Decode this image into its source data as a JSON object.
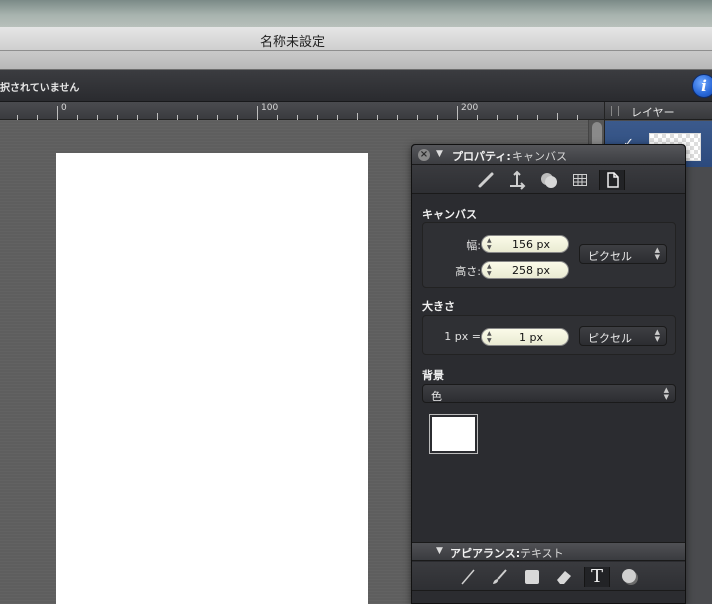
{
  "window": {
    "title": "名称未設定"
  },
  "statusbar": {
    "text": "択されていません",
    "info_label": "i"
  },
  "ruler": {
    "labels": [
      "0",
      "100",
      "200"
    ]
  },
  "layers_panel": {
    "title": "レイヤー",
    "visible_check": "✓"
  },
  "properties_panel": {
    "close_glyph": "×",
    "disclosure": "▼",
    "title_bold": "プロパティ:",
    "title_context": "キャンバス",
    "tool_icons": [
      "ruler-icon",
      "transform-icon",
      "shape-icon",
      "grid-icon",
      "document-icon"
    ],
    "canvas_section": {
      "title": "キャンバス",
      "width_label": "幅:",
      "width_value": "156 px",
      "height_label": "高さ:",
      "height_value": "258 px",
      "unit_select": "ピクセル"
    },
    "size_section": {
      "title": "大きさ",
      "ratio_label": "1 px =",
      "ratio_value": "1 px",
      "unit_select": "ピクセル"
    },
    "background_section": {
      "title": "背景",
      "type_select": "色",
      "swatch_color": "#ffffff"
    }
  },
  "appearance_panel": {
    "disclosure": "▼",
    "title_bold": "アピアランス:",
    "title_context": "テキスト",
    "tool_icons": [
      "line-icon",
      "brush-icon",
      "rectangle-icon",
      "eraser-icon",
      "text-icon",
      "shadow-icon"
    ],
    "text_tool_glyph": "T"
  },
  "colors": {
    "accent_blue": "#2c4a7d",
    "field_bg": "#f4f5de"
  }
}
